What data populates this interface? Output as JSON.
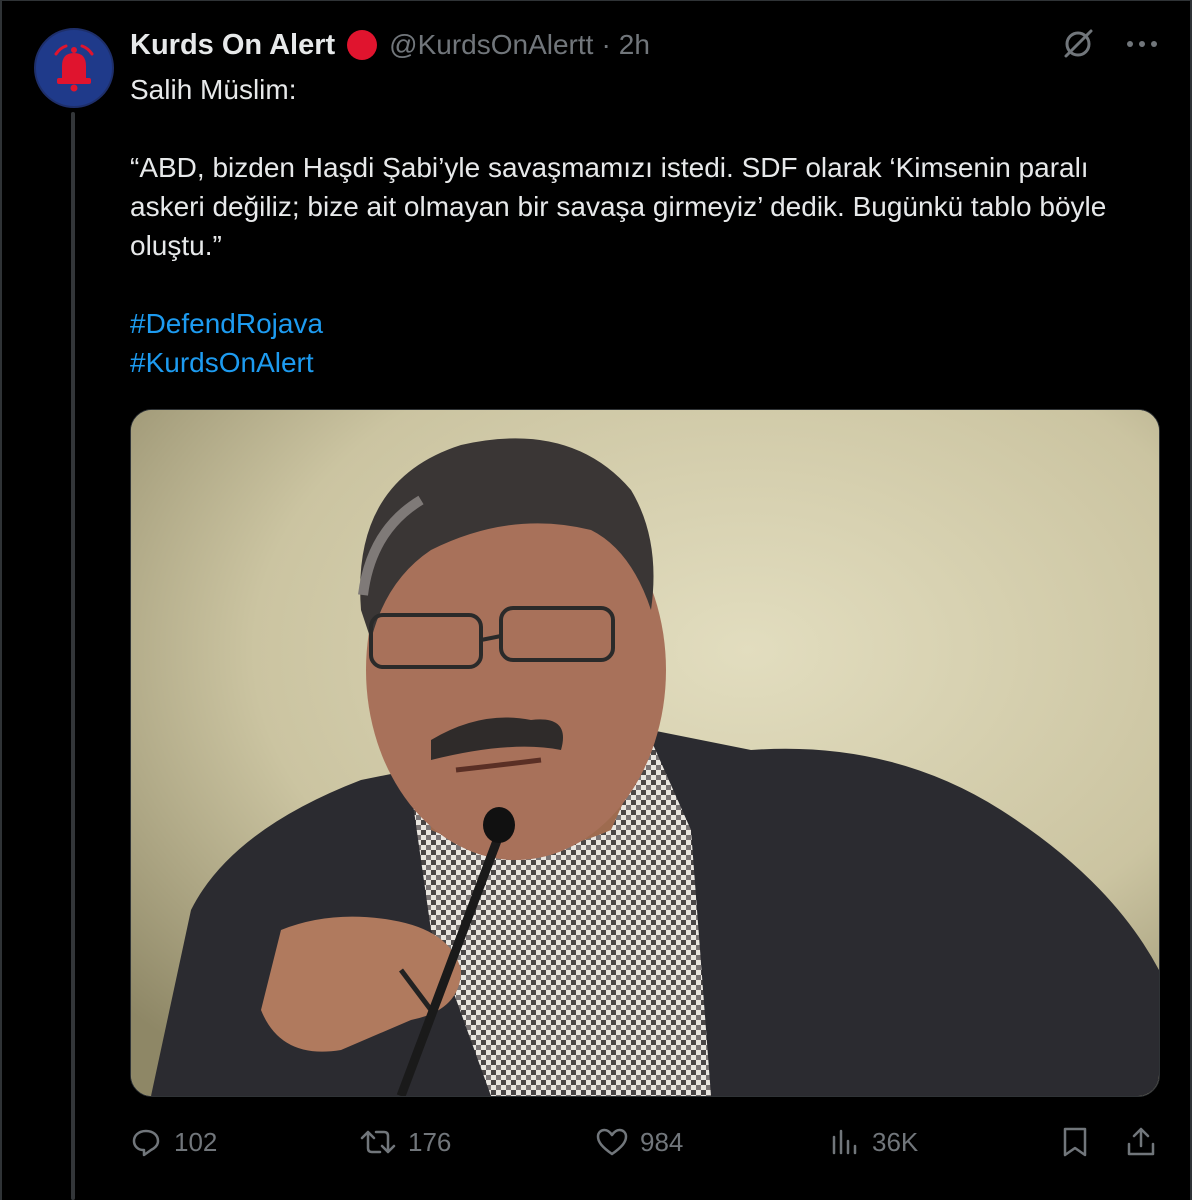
{
  "post": {
    "author_name": "Kurds On Alert",
    "handle": "@KurdsOnAlertt",
    "separator": "·",
    "time": "2h",
    "intro": "Salih Müslim:",
    "quote": "“ABD, bizden Haşdi Şabi’yle savaşmamızı istedi. SDF olarak ‘Kimsenin paralı askeri değiliz; bize ait olmayan bir savaşa girmeyiz’ dedik. Bugünkü tablo böyle oluştu.”",
    "hashtags": [
      "#DefendRojava",
      "#KurdsOnAlert"
    ],
    "image_icon": "photo-of-speaker-at-microphone"
  },
  "metrics": {
    "replies": "102",
    "reposts": "176",
    "likes": "984",
    "views": "36K"
  },
  "icons": {
    "avatar": "alarm-bell-icon",
    "verified_badge": "red-circle-badge",
    "grok": "grok-icon",
    "more": "more-icon",
    "reply": "reply-icon",
    "repost": "repost-icon",
    "like": "heart-icon",
    "views": "views-icon",
    "bookmark": "bookmark-icon",
    "share": "share-icon"
  },
  "colors": {
    "background": "#000000",
    "text": "#e7e9ea",
    "muted": "#71767b",
    "link": "#1d9bf0",
    "badge": "#e0142e",
    "avatar_bg": "#1f3a8a"
  }
}
